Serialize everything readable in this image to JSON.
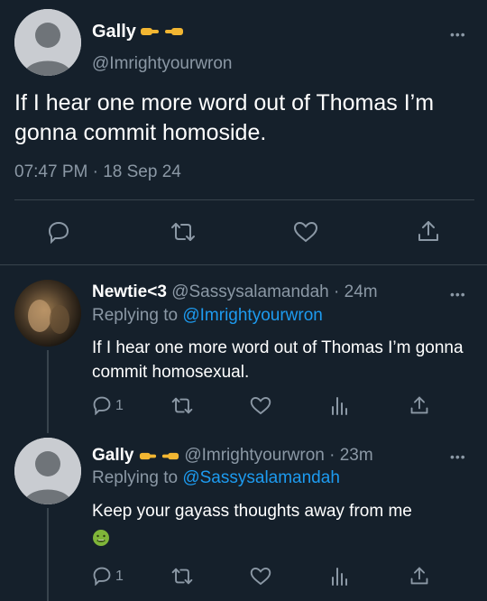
{
  "main_tweet": {
    "name": "Gally",
    "handle": "@Imrightyourwron",
    "text": "If I hear one more word out of Thomas I’m gonna commit homoside.",
    "timestamp": "07:47 PM · 18 Sep 24",
    "actions": [
      "reply-icon",
      "retweet-icon",
      "like-icon",
      "share-icon"
    ]
  },
  "replies": [
    {
      "name": "Newtie<3",
      "handle": "@Sassysalamandah",
      "time": "· 24m",
      "replying_prefix": "Replying to ",
      "replying_to": "@Imrightyourwron",
      "text": "If I hear one more word out of Thomas I’m gonna commit homosexual.",
      "reply_count": "1"
    },
    {
      "name": "Gally",
      "handle": "@Imrightyourwron",
      "time": "· 23m",
      "replying_prefix": "Replying to ",
      "replying_to": "@Sassysalamandah",
      "text": "Keep your gayass thoughts away from me",
      "emoji": "nauseated-face-emoji",
      "reply_count": "1"
    }
  ],
  "colors": {
    "background": "#15202b",
    "text": "#ffffff",
    "secondary": "#8b98a5",
    "link": "#1d9bf0",
    "divider": "#38444d"
  }
}
